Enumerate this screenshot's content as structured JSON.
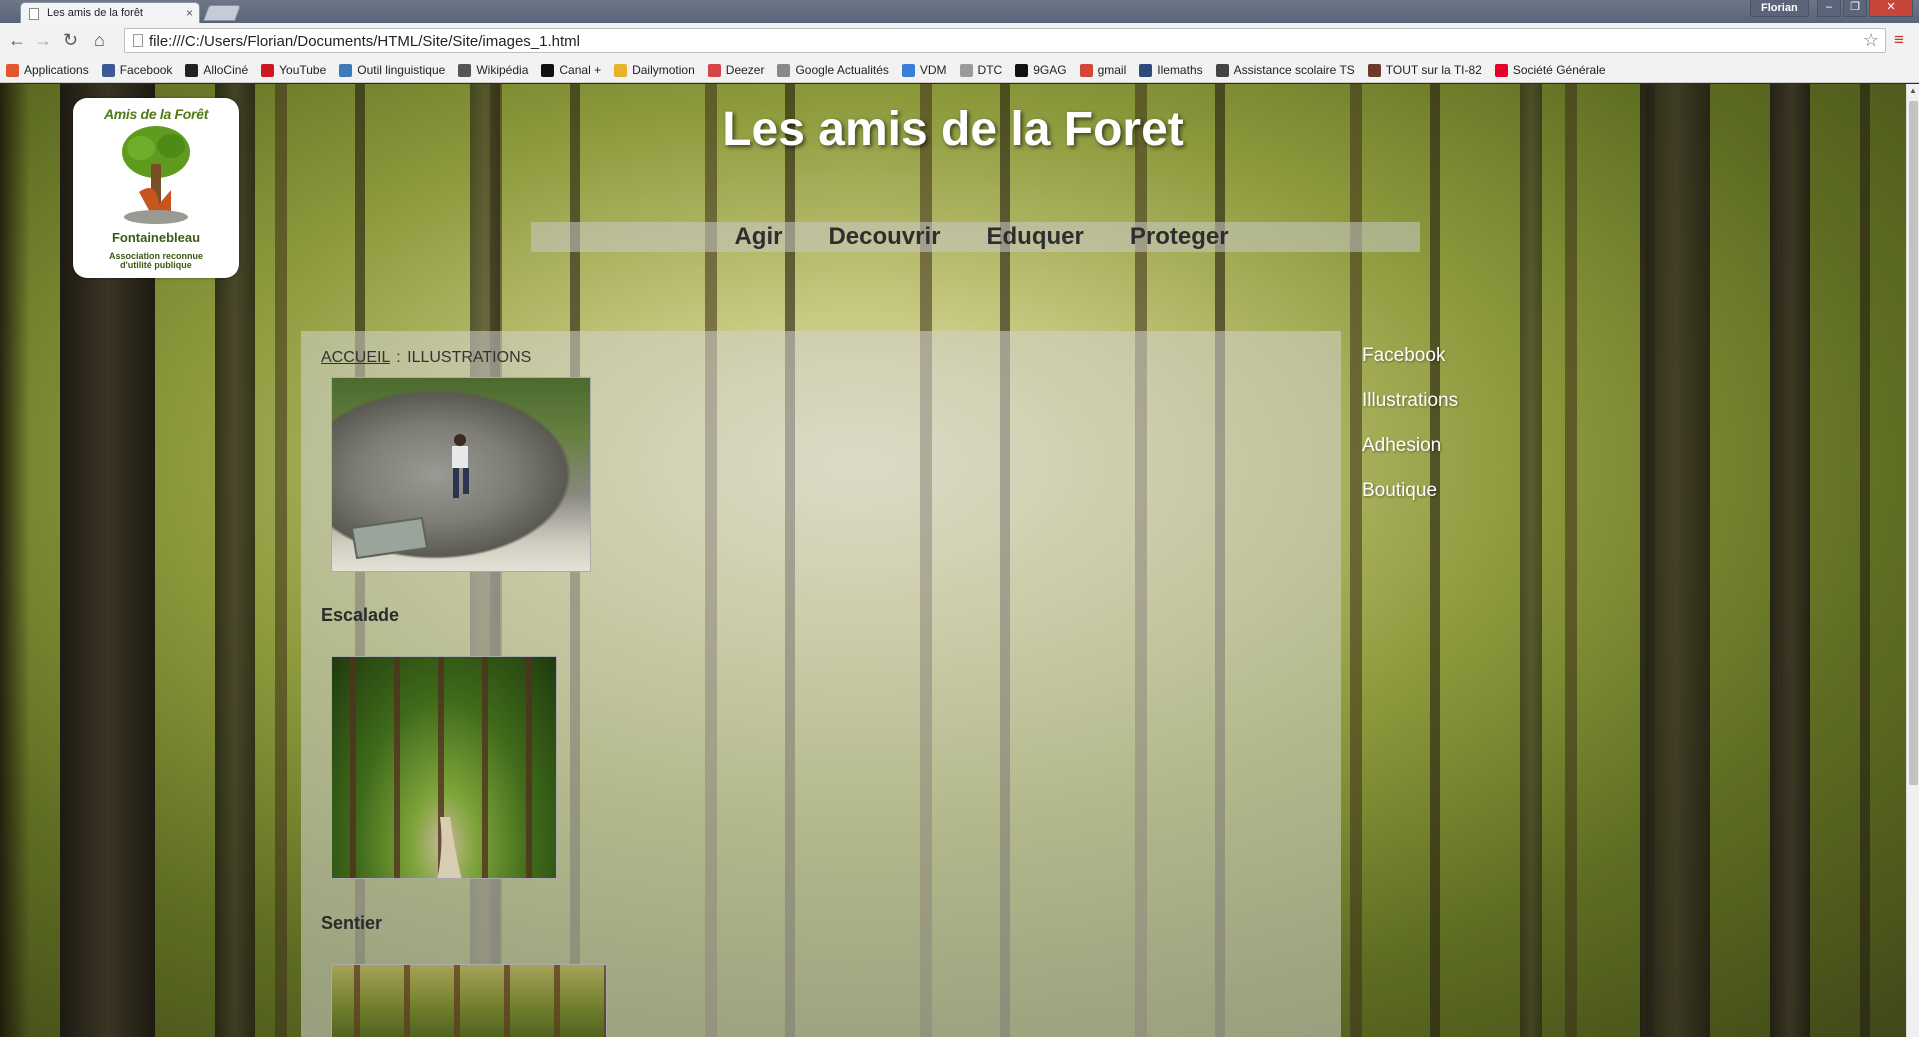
{
  "browser": {
    "tab_title": "Les amis de la forêt",
    "tab_close": "×",
    "user_name": "Florian",
    "window_controls": [
      "–",
      "❐",
      "✕"
    ],
    "back": "←",
    "forward": "→",
    "reload": "↻",
    "home": "⌂",
    "url": "file:///C:/Users/Florian/Documents/HTML/Site/Site/images_1.html",
    "star": "☆",
    "menu": "≡"
  },
  "bookmarks": [
    {
      "label": "Applications",
      "icon": "apps-grid-icon",
      "color": "#e4572e"
    },
    {
      "label": "Facebook",
      "icon": "facebook-icon",
      "color": "#3b5998"
    },
    {
      "label": "AlloCiné",
      "icon": "allocine-icon",
      "color": "#222222"
    },
    {
      "label": "YouTube",
      "icon": "youtube-icon",
      "color": "#cc181e"
    },
    {
      "label": "Outil linguistique",
      "icon": "linguistic-tool-icon",
      "color": "#3d7ab8"
    },
    {
      "label": "Wikipédia",
      "icon": "wikipedia-icon",
      "color": "#555555"
    },
    {
      "label": "Canal +",
      "icon": "canal-plus-icon",
      "color": "#111111"
    },
    {
      "label": "Dailymotion",
      "icon": "dailymotion-icon",
      "color": "#e8b22c"
    },
    {
      "label": "Deezer",
      "icon": "deezer-icon",
      "color": "#d64545"
    },
    {
      "label": "Google Actualités",
      "icon": "google-news-icon",
      "color": "#888888"
    },
    {
      "label": "VDM",
      "icon": "vdm-icon",
      "color": "#3b7dd8"
    },
    {
      "label": "DTC",
      "icon": "dtc-icon",
      "color": "#9a9a9a"
    },
    {
      "label": "9GAG",
      "icon": "9gag-icon",
      "color": "#111111"
    },
    {
      "label": "gmail",
      "icon": "gmail-icon",
      "color": "#d44638"
    },
    {
      "label": "Ilemaths",
      "icon": "ilemaths-icon",
      "color": "#2c4a7a"
    },
    {
      "label": "Assistance scolaire TS",
      "icon": "assistance-scolaire-icon",
      "color": "#444444"
    },
    {
      "label": "TOUT sur la TI-82",
      "icon": "ti82-icon",
      "color": "#6b3a2a"
    },
    {
      "label": "Société Générale",
      "icon": "societe-generale-icon",
      "color": "#e60028"
    }
  ],
  "site": {
    "title": "Les amis de la Foret",
    "logo": {
      "arc_text": "Amis de la Forêt",
      "brand": "Fontainebleau",
      "tagline": "Association reconnue d'utilité publique"
    },
    "nav": [
      "Agir",
      "Decouvrir",
      "Eduquer",
      "Proteger"
    ],
    "breadcrumb": {
      "home": "ACCUEIL",
      "separator": ":",
      "current": "ILLUSTRATIONS"
    },
    "gallery": [
      {
        "caption": "Escalade",
        "image": "climbing-photo"
      },
      {
        "caption": "Sentier",
        "image": "forest-path-photo"
      },
      {
        "caption": "",
        "image": "forest-photo"
      }
    ],
    "side_links": [
      "Facebook",
      "Illustrations",
      "Adhesion",
      "Boutique"
    ]
  },
  "colors": {
    "nav_text": "#2e2e2e",
    "side_link_text": "#ffffff",
    "logo_green": "#3a5a13"
  }
}
